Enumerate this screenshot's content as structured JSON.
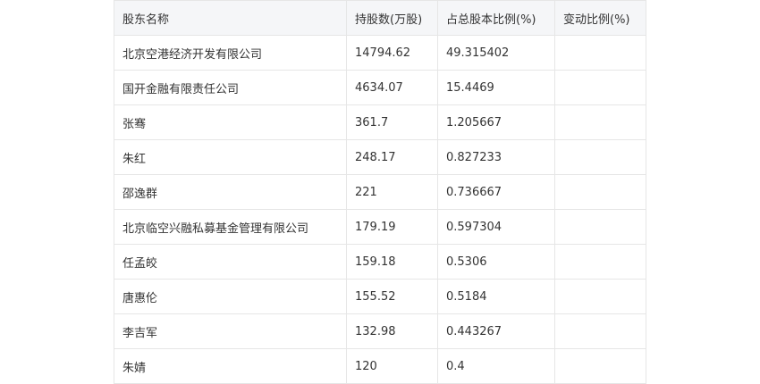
{
  "table": {
    "headers": [
      "股东名称",
      "持股数(万股)",
      "占总股本比例(%)",
      "变动比例(%)"
    ],
    "rows": [
      [
        "北京空港经济开发有限公司",
        "14794.62",
        "49.315402",
        ""
      ],
      [
        "国开金融有限责任公司",
        "4634.07",
        "15.4469",
        ""
      ],
      [
        "张骞",
        "361.7",
        "1.205667",
        ""
      ],
      [
        "朱红",
        "248.17",
        "0.827233",
        ""
      ],
      [
        "邵逸群",
        "221",
        "0.736667",
        ""
      ],
      [
        "北京临空兴融私募基金管理有限公司",
        "179.19",
        "0.597304",
        ""
      ],
      [
        "任孟皎",
        "159.18",
        "0.5306",
        ""
      ],
      [
        "唐惠伦",
        "155.52",
        "0.5184",
        ""
      ],
      [
        "李吉军",
        "132.98",
        "0.443267",
        ""
      ],
      [
        "朱婧",
        "120",
        "0.4",
        ""
      ]
    ]
  }
}
